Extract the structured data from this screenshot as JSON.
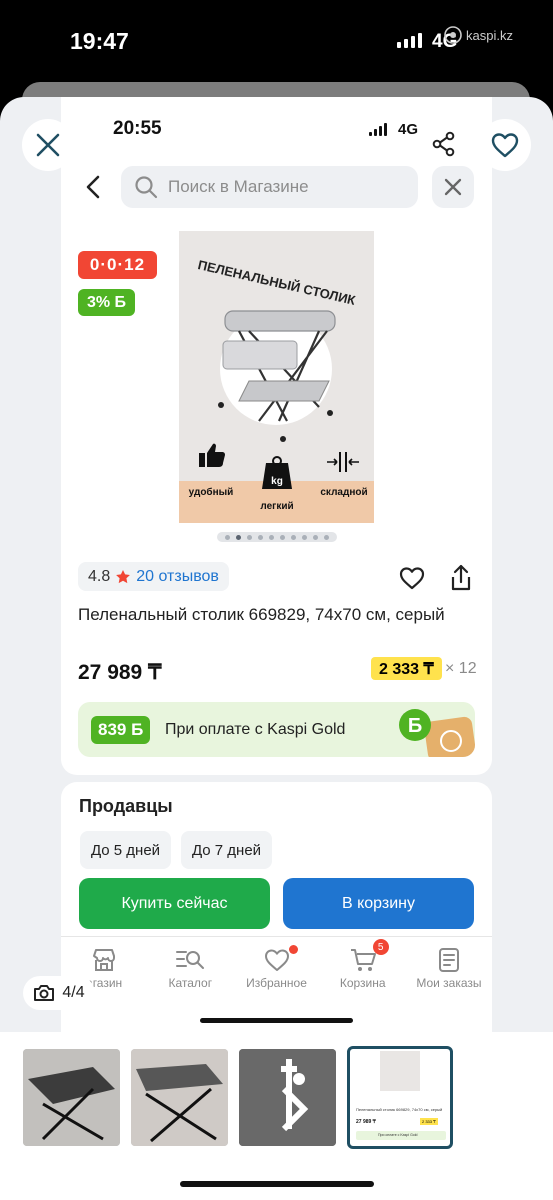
{
  "outer_status": {
    "time": "19:47",
    "network": "4G",
    "badge": "kaspi.kz"
  },
  "inner_status": {
    "time": "20:55",
    "network": "4G"
  },
  "search": {
    "placeholder": "Поиск в Магазине"
  },
  "badges": {
    "timer": "0·0·12",
    "bonus": "3% Б"
  },
  "product_image": {
    "headline": "ПЕЛЕНАЛЬНЫЙ СТОЛИК",
    "features": [
      "удобный",
      "легкий",
      "складной"
    ],
    "weight_icon_text": "kg"
  },
  "gallery": {
    "dots_total": 10,
    "active_dot": 1
  },
  "rating": {
    "value": "4.8",
    "reviews": "20 отзывов"
  },
  "product": {
    "title": "Пеленальный столик 669829, 74x70 см, серый",
    "price": "27 989 ₸",
    "installment": "2 333 ₸",
    "installment_months": "× 12"
  },
  "kaspi_gold": {
    "bonus": "839 Б",
    "text": "При оплате с Kaspi Gold"
  },
  "sellers": {
    "heading": "Продавцы",
    "chips": [
      "До 5 дней",
      "До 7 дней"
    ]
  },
  "actions": {
    "buy": "Купить сейчас",
    "cart": "В корзину"
  },
  "tabbar": {
    "items": [
      {
        "label": "агазин",
        "icon": "store-icon"
      },
      {
        "label": "Каталог",
        "icon": "catalog-search-icon"
      },
      {
        "label": "Избранное",
        "icon": "heart-icon"
      },
      {
        "label": "Корзина",
        "icon": "cart-icon"
      },
      {
        "label": "Мои заказы",
        "icon": "orders-icon"
      }
    ],
    "cart_count": "5"
  },
  "photo_counter": "4/4",
  "thumb_mini": {
    "title": "Пеленальный столик 669829, 74x70 см, серый",
    "price": "27 989 ₸",
    "installment": "2 333 ₸",
    "gold_text": "При оплате с Kaspi Gold"
  },
  "colors": {
    "red": "#f14634",
    "green": "#4fb323",
    "blue": "#1f75d0",
    "buy_green": "#1faa4a",
    "yellow": "#ffe24d"
  }
}
